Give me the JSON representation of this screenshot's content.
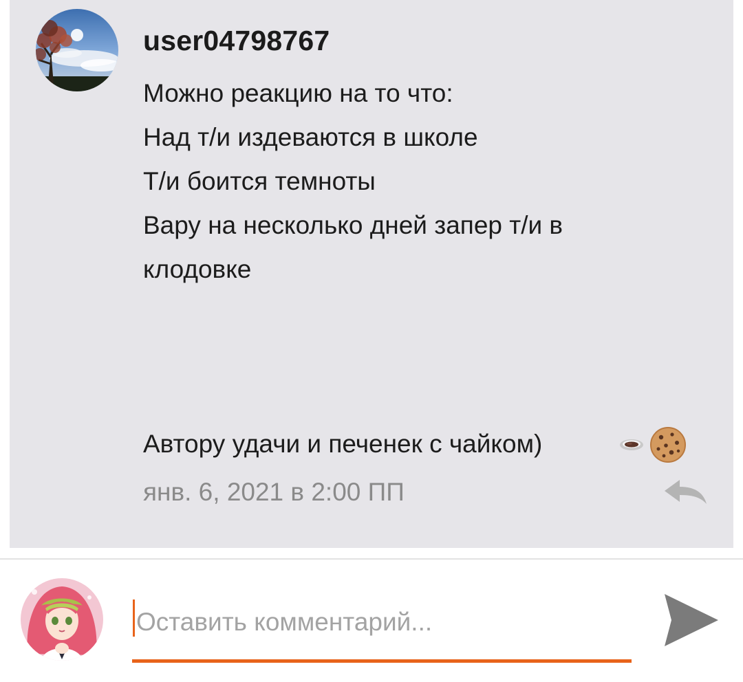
{
  "comment": {
    "author": "user04798767",
    "avatar": "avatar-tree-sky",
    "lines": [
      "Можно реакцию на то что:",
      "Над т/и издеваются в школе",
      "Т/и боится темноты",
      "Вару на несколько дней запер т/и в",
      "клодовке"
    ],
    "closing": "Автору удачи и печенек с чайком)",
    "emoji": [
      "tea-cup-emoji",
      "cookie-emoji"
    ],
    "timestamp": "янв. 6, 2021 в 2:00 ПП",
    "reply_icon": "reply-icon"
  },
  "composer": {
    "avatar": "avatar-anime-girl",
    "placeholder": "Оставить комментарий...",
    "value": "",
    "send_icon": "send-icon"
  },
  "colors": {
    "card_bg": "#e6e5e9",
    "accent": "#e8631a",
    "timestamp": "#8a8a8a",
    "placeholder": "#a3a3a3"
  }
}
